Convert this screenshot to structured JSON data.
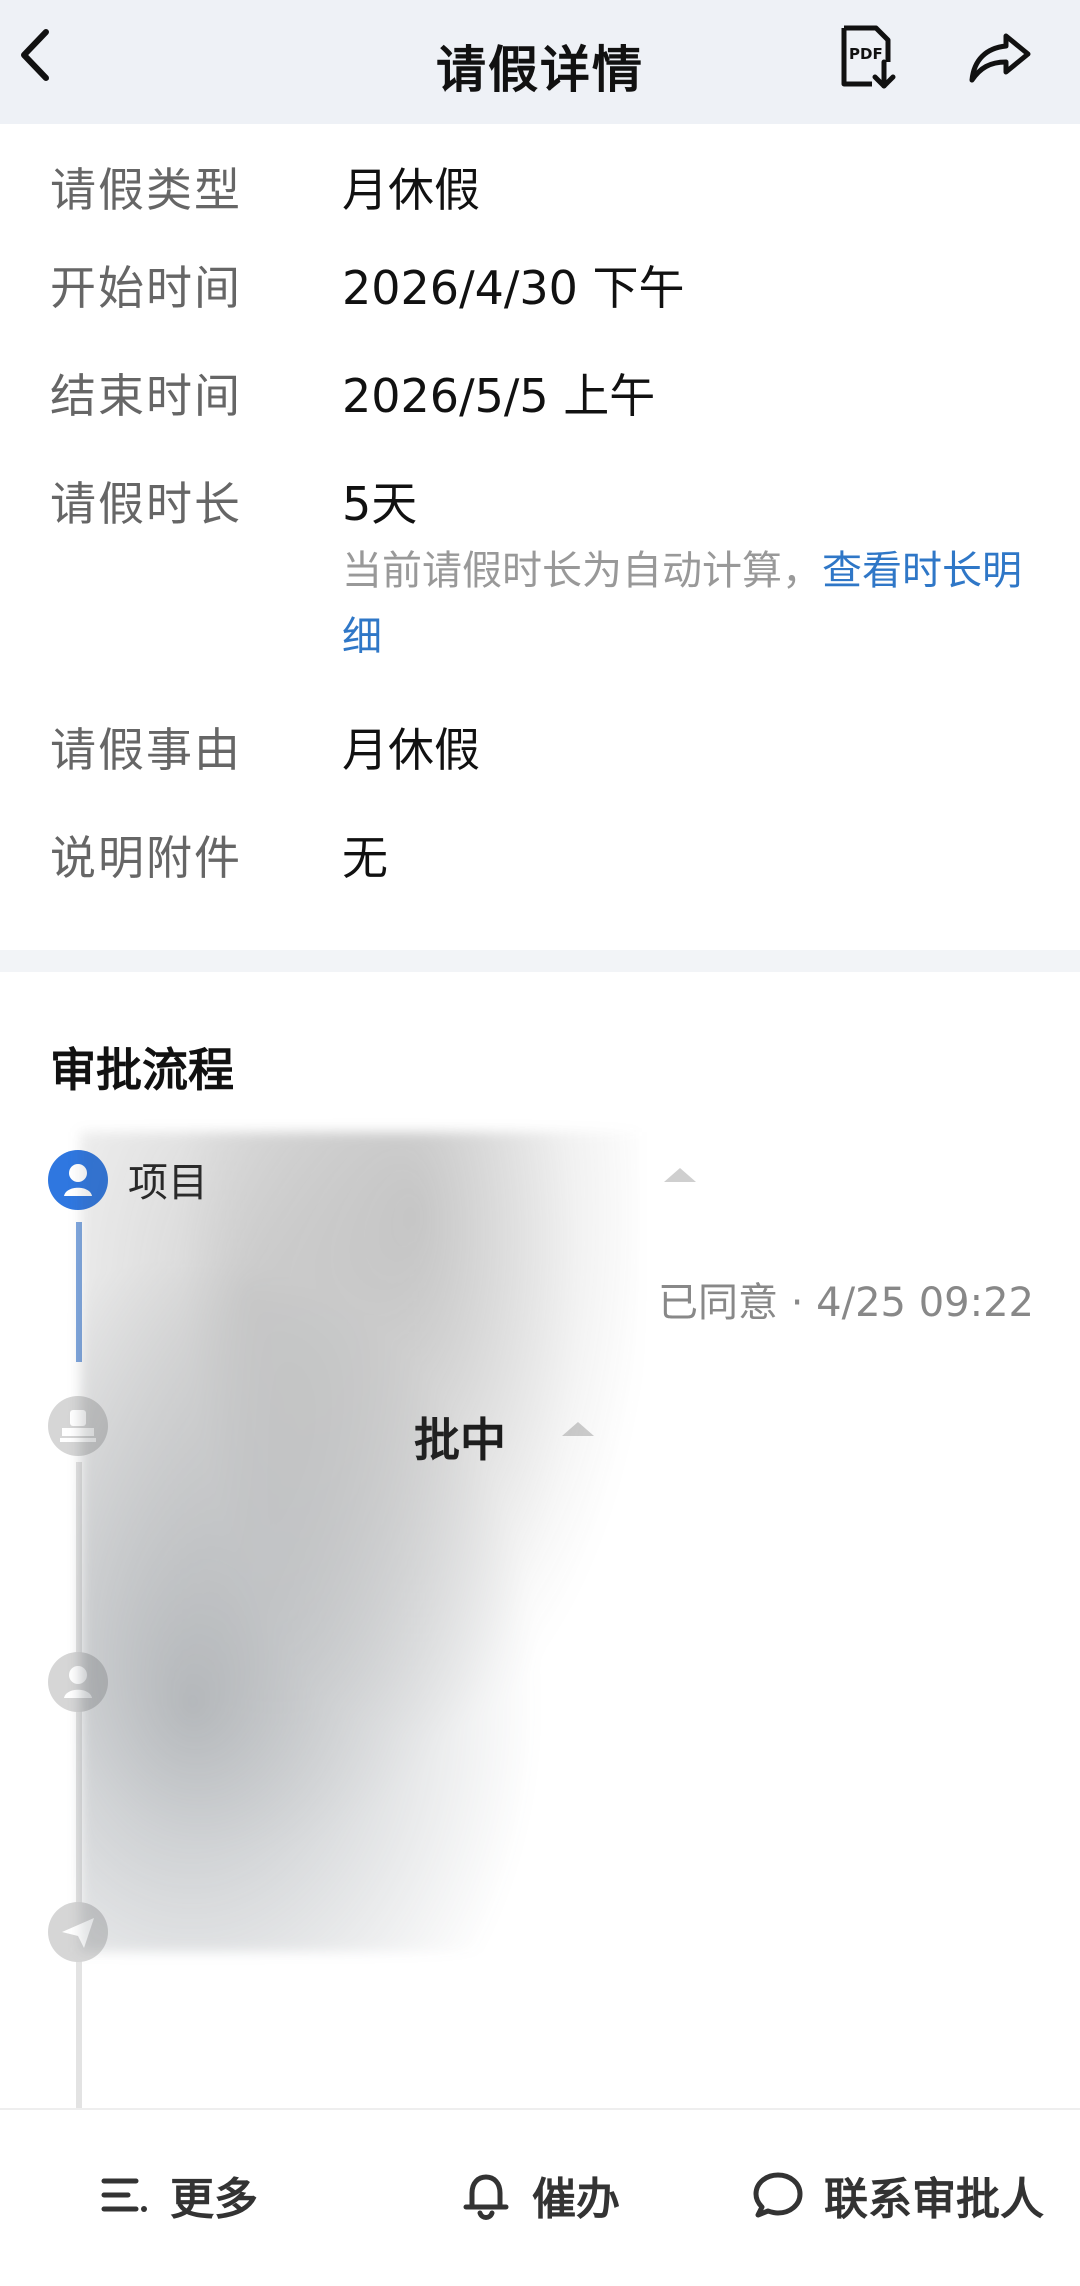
{
  "header": {
    "title": "请假详情",
    "back_icon": "chevron-left-icon",
    "pdf_icon": "pdf-download-icon",
    "share_icon": "share-icon"
  },
  "details": [
    {
      "label": "请假类型",
      "value": "月休假"
    },
    {
      "label": "开始时间",
      "value": "2026/4/30 下午"
    },
    {
      "label": "结束时间",
      "value": "2026/5/5 上午"
    },
    {
      "label": "请假时长",
      "value": "5天"
    },
    {
      "label": "请假事由",
      "value": "月休假"
    },
    {
      "label": "说明附件",
      "value": "无"
    }
  ],
  "duration_hint": {
    "text": "当前请假时长为自动计算，",
    "link": "查看时长明细"
  },
  "approval": {
    "title": "审批流程",
    "first_node_title": "项目",
    "first_status": "已同意 · 4/25 09:22",
    "second_status": "批中"
  },
  "colors": {
    "accent": "#2f77e0",
    "link": "#2f77c7",
    "header_bg": "#eef1f6"
  },
  "bottom": {
    "more": "更多",
    "remind": "催办",
    "contact": "联系审批人"
  }
}
